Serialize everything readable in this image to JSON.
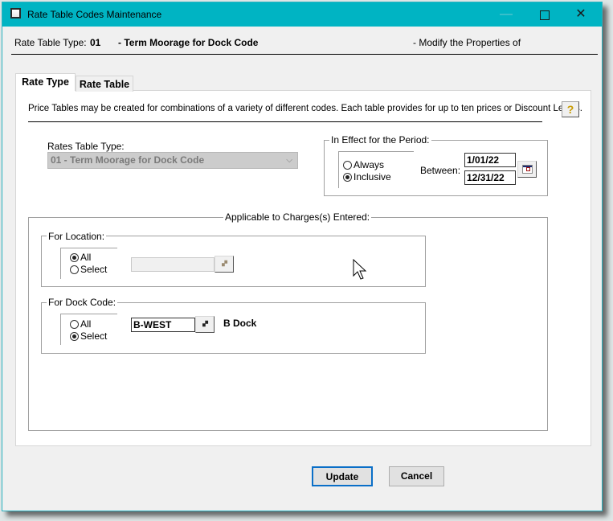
{
  "window": {
    "title": "Rate Table Codes Maintenance",
    "controls": {
      "minimize": "—",
      "close": "✕"
    },
    "titlebar_color": "#00b4c3"
  },
  "header": {
    "rate_table_type_label": "Rate Table Type:",
    "rate_table_type_code": "01",
    "rate_table_type_desc": "- Term Moorage for Dock Code",
    "mode_text": "- Modify the Properties of"
  },
  "tabs": [
    {
      "label": "Rate Type",
      "active": true
    },
    {
      "label": "Rate Table",
      "active": false
    }
  ],
  "rate_type_tab": {
    "intro": "Price Tables may be created for combinations of a variety of different codes.  Each table provides for up to ten prices or Discount Levels.",
    "help_icon": "help-icon",
    "rates_table_type": {
      "label": "Rates Table Type:",
      "value": "01 - Term Moorage for Dock Code",
      "chevron": "⌵"
    },
    "period": {
      "title": "In Effect for the Period:",
      "options": [
        {
          "label": "Always",
          "selected": false
        },
        {
          "label": "Inclusive",
          "selected": true
        }
      ],
      "between_label": "Between:",
      "start_date": "1/01/22",
      "end_date": "12/31/22",
      "calendar_icon": "calendar-icon"
    },
    "applicable": {
      "title": "Applicable to Charges(s) Entered:",
      "location": {
        "title": "For Location:",
        "options": [
          {
            "label": "All",
            "selected": true
          },
          {
            "label": "Select",
            "selected": false
          }
        ],
        "code_value": "",
        "lookup_icon": "binoculars-icon"
      },
      "dock_code": {
        "title": "For Dock Code:",
        "options": [
          {
            "label": "All",
            "selected": false
          },
          {
            "label": "Select",
            "selected": true
          }
        ],
        "code_value": "B-WEST",
        "code_desc": "B Dock",
        "lookup_icon": "binoculars-icon"
      }
    }
  },
  "buttons": {
    "update": "Update",
    "cancel": "Cancel"
  },
  "glyphs": {
    "binoculars": "🙾",
    "help": "?"
  }
}
